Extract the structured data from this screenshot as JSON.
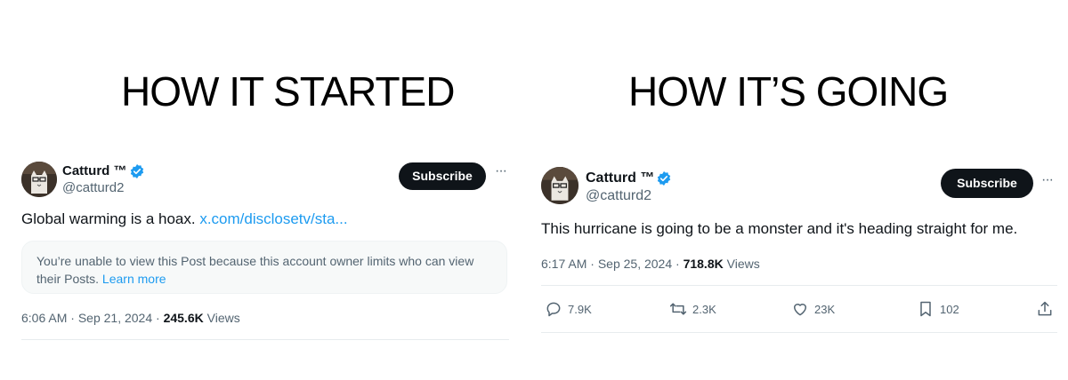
{
  "headlines": {
    "left": "HOW IT STARTED",
    "right": "HOW IT’S GOING"
  },
  "left_tweet": {
    "display_name": "Catturd ™",
    "handle": "@catturd2",
    "subscribe_label": "Subscribe",
    "more_label": "···",
    "text": "Global warming is a hoax.",
    "link_text": "x.com/disclosetv/sta...",
    "notice": {
      "text": "You’re unable to view this Post because this account owner limits who can view their Posts.",
      "link": "Learn more"
    },
    "time": "6:06 AM",
    "date": "Sep 21, 2024",
    "views_count": "245.6K",
    "views_label": "Views"
  },
  "right_tweet": {
    "display_name": "Catturd ™",
    "handle": "@catturd2",
    "subscribe_label": "Subscribe",
    "more_label": "···",
    "text": "This hurricane is going to be a monster and it's heading straight for me.",
    "time": "6:17 AM",
    "date": "Sep 25, 2024",
    "views_count": "718.8K",
    "views_label": "Views",
    "actions": {
      "replies": "7.9K",
      "reposts": "2.3K",
      "likes": "23K",
      "bookmarks": "102"
    }
  },
  "icons": {
    "verified": "verified-badge-icon",
    "more": "more-dots-icon",
    "reply": "reply-icon",
    "repost": "repost-icon",
    "like": "heart-icon",
    "bookmark": "bookmark-icon",
    "share": "share-icon"
  },
  "colors": {
    "text": "#0f1419",
    "secondary": "#536471",
    "link": "#1d9bf0",
    "button": "#0f1419",
    "verified": "#1d9bf0"
  }
}
